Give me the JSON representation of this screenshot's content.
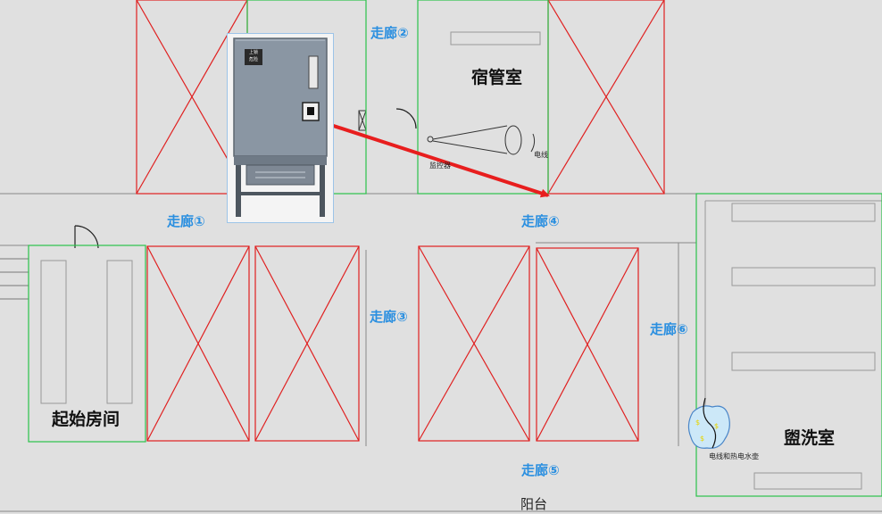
{
  "corridors": {
    "c1": "走廊①",
    "c2": "走廊②",
    "c3": "走廊③",
    "c4": "走廊④",
    "c5": "走廊⑤",
    "c6": "走廊⑥"
  },
  "rooms": {
    "dorm_manager": "宿管室",
    "start_room": "起始房间",
    "washroom": "盥洗室",
    "balcony": "阳台"
  },
  "annotations": {
    "cctv": "监控器",
    "cable": "电线",
    "water_heater": "电线和热电水壶"
  },
  "cabinet_panel": {
    "sign_line1": "上锁",
    "sign_line2": "危险"
  },
  "colors": {
    "locked_room": "#e02020",
    "accessible_room": "#2bc24a",
    "corridor_label": "#2a8fe0",
    "path_arrow": "#e81e1e",
    "background": "#e0e0e0"
  },
  "legend_semantics": {
    "red_cross": "locked-room",
    "green_outline": "accessible-room"
  }
}
